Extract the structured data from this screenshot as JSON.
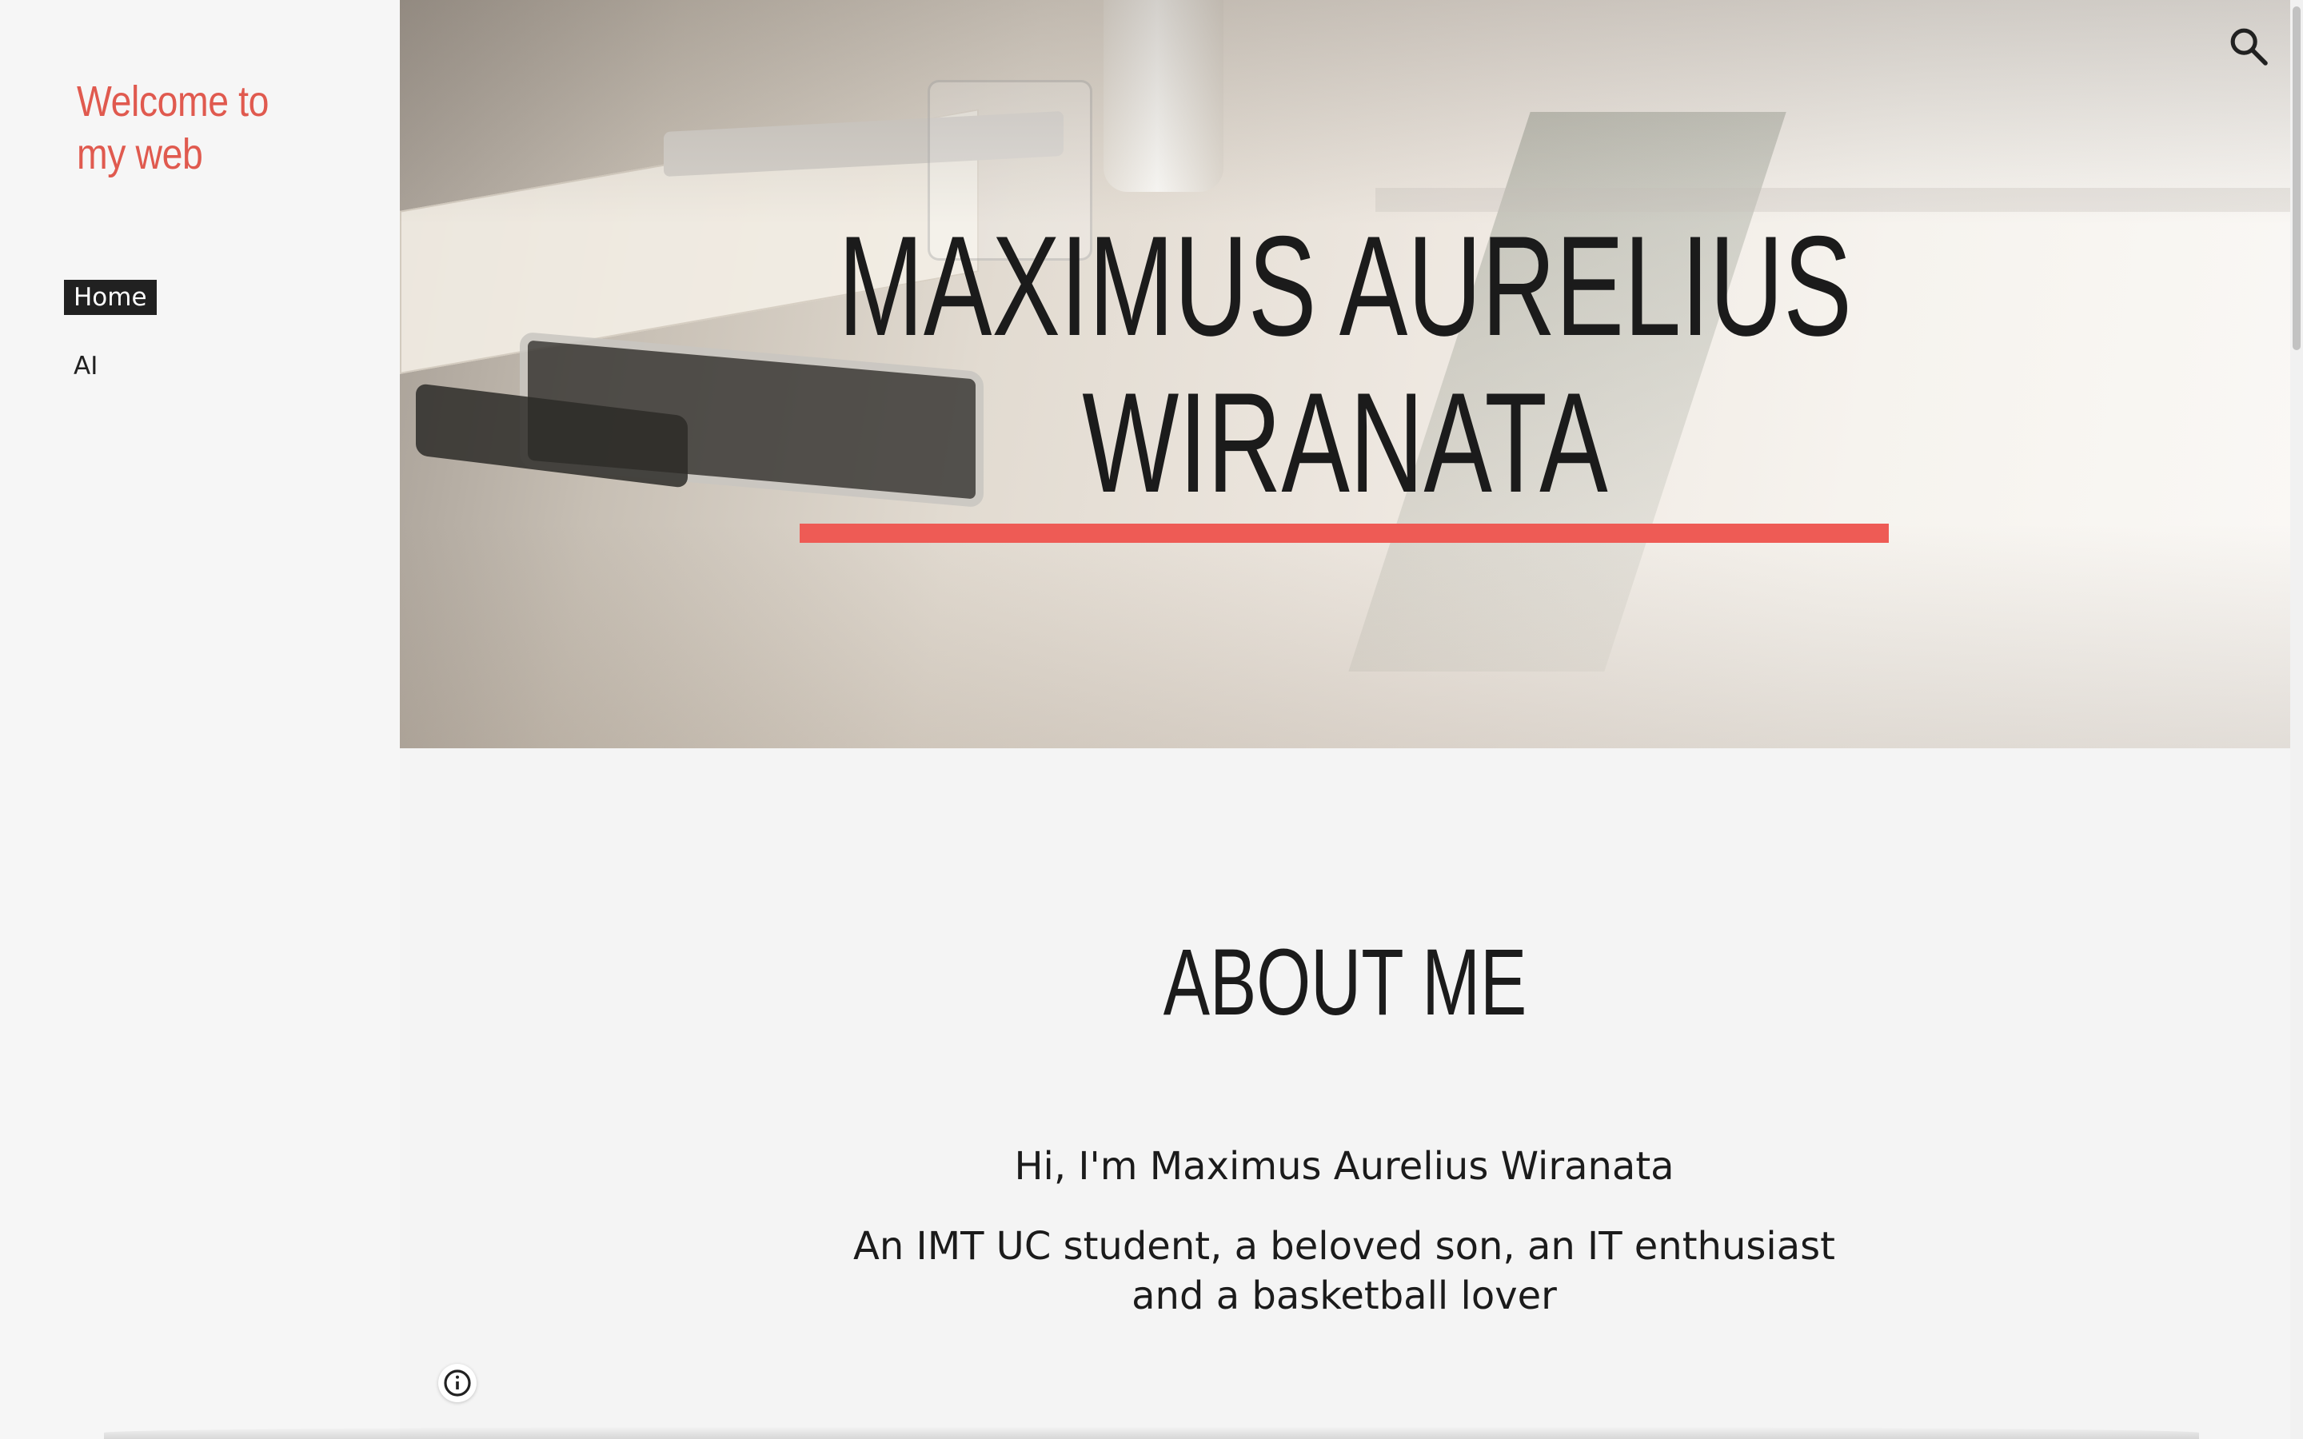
{
  "sidebar": {
    "site_title": "Welcome to my web",
    "nav_items": [
      {
        "label": "Home",
        "active": true
      },
      {
        "label": "AI",
        "active": false
      }
    ]
  },
  "hero": {
    "title": "MAXIMUS AURELIUS WIRANATA",
    "rule_color": "#ee5b55"
  },
  "header": {
    "search_icon": "search-icon"
  },
  "main": {
    "heading": "ABOUT ME",
    "greeting": "Hi, I'm Maximus Aurelius Wiranata",
    "description": "An IMT UC student, a beloved son, an IT enthusiast and a basketball lover"
  },
  "footer": {
    "info_icon": "info-icon"
  },
  "colors": {
    "accent": "#e05a4f",
    "nav_active_bg": "#212121",
    "page_bg": "#f4f4f4"
  }
}
